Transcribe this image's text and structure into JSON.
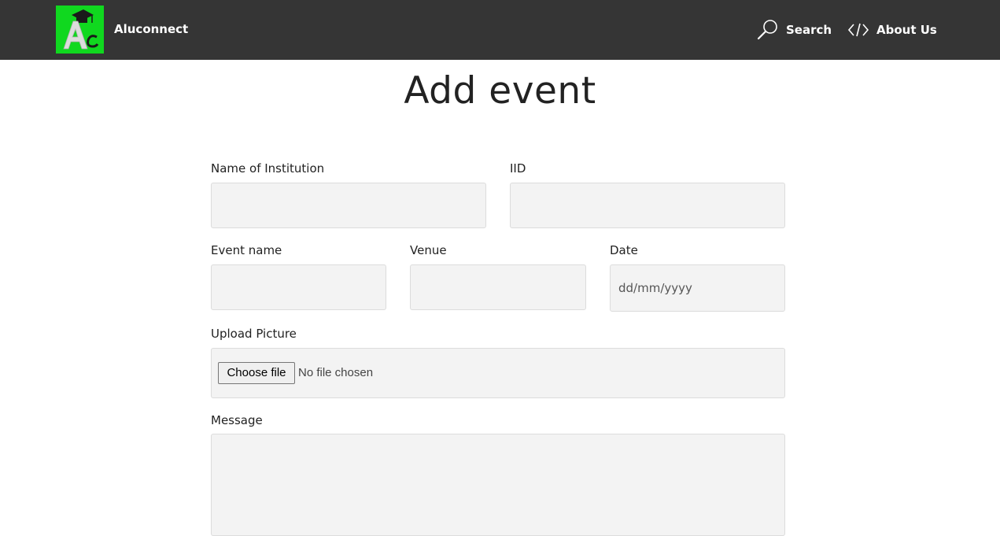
{
  "header": {
    "brand": "Aluconnect",
    "logo_text": "Ac",
    "nav": [
      {
        "label": "Search",
        "icon": "search-icon"
      },
      {
        "label": "About Us",
        "icon": "code-icon"
      }
    ]
  },
  "page": {
    "title": "Add event"
  },
  "form": {
    "institution_label": "Name of Institution",
    "iid_label": "IID",
    "event_name_label": "Event name",
    "venue_label": "Venue",
    "date_label": "Date",
    "date_placeholder": "dd/mm/yyyy",
    "upload_label": "Upload Picture",
    "choose_file_label": "Choose file",
    "no_file_text": "No file chosen",
    "message_label": "Message"
  },
  "colors": {
    "navbar": "#353535",
    "logo_bg": "#10d81f",
    "field_bg": "#f3f3f3"
  }
}
